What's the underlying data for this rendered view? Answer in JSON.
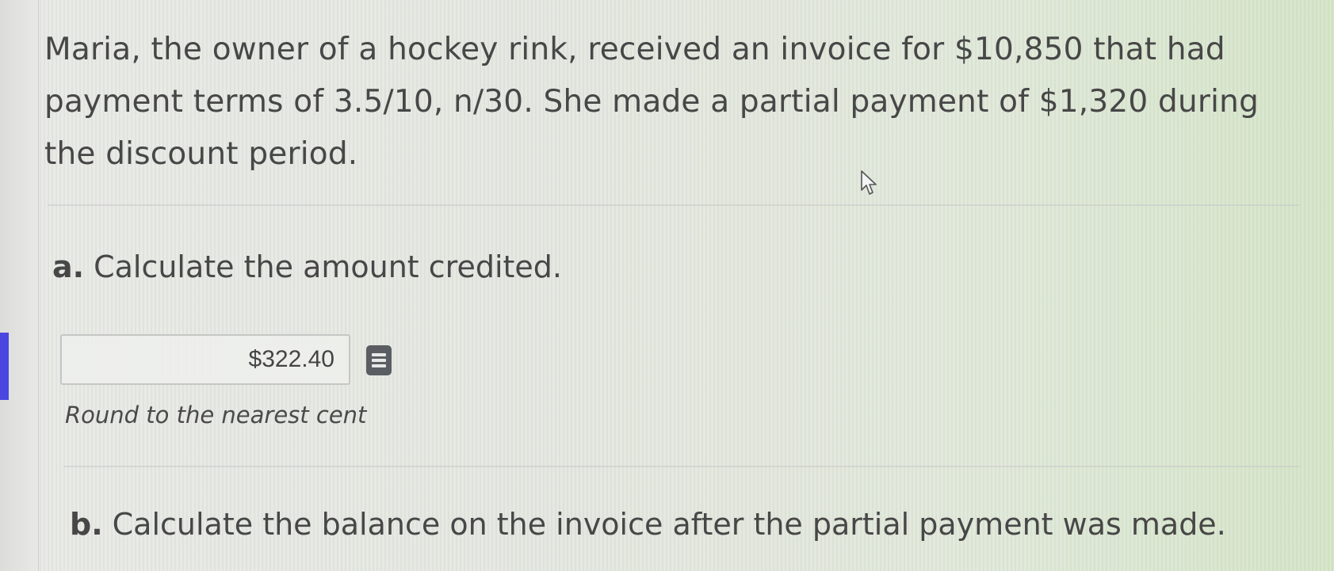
{
  "question": {
    "text": "Maria, the owner of a hockey rink, received an invoice for $10,850 that had payment terms of 3.5/10, n/30. She made a partial payment of $1,320 during the discount period."
  },
  "part_a": {
    "letter": "a.",
    "prompt": "Calculate the amount credited.",
    "answer_value": "$322.40",
    "hint": "Round to the nearest cent"
  },
  "part_b": {
    "letter": "b.",
    "prompt": "Calculate the balance on the invoice after the partial payment was made."
  },
  "icons": {
    "calculator": "calculator-icon",
    "cursor": "mouse-pointer-icon"
  },
  "colors": {
    "accent": "#4a47e0",
    "text": "#474747",
    "icon": "#5a5d62"
  }
}
